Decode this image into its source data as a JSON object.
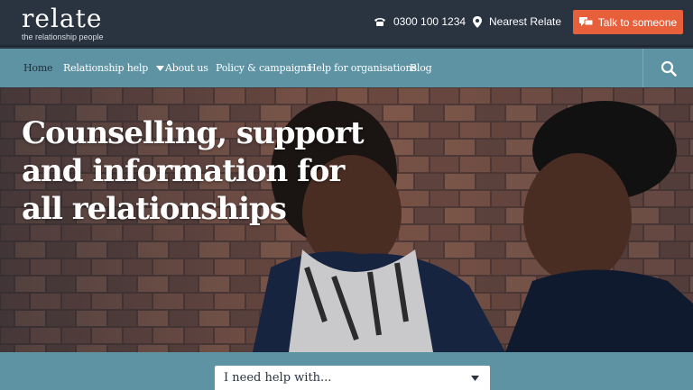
{
  "brand": {
    "name": "relate",
    "tagline": "the relationship people"
  },
  "topbar": {
    "phone": "0300 100 1234",
    "nearest": "Nearest Relate",
    "talk_button": "Talk to someone",
    "accent_color": "#e8603b"
  },
  "nav": {
    "items": [
      {
        "label": "Home"
      },
      {
        "label": "Relationship help"
      },
      {
        "label": "About us"
      },
      {
        "label": "Policy & campaigns"
      },
      {
        "label": "Help for organisations"
      },
      {
        "label": "Blog"
      }
    ],
    "search_icon": "search-icon",
    "nav_color": "#5e93a3"
  },
  "hero": {
    "title": "Counselling, support and information for all relationships"
  },
  "help": {
    "select_value": "I need help with..."
  }
}
